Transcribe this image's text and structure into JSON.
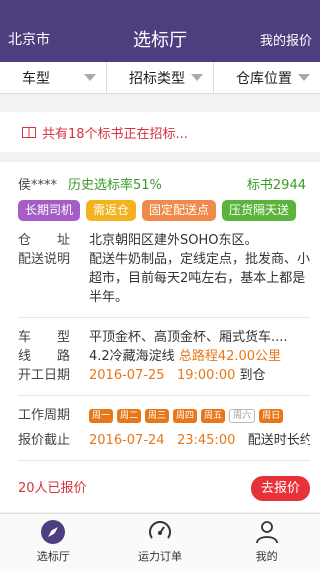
{
  "header": {
    "city": "北京市",
    "title": "选标厅",
    "my_quote": "我的报价"
  },
  "filters": [
    {
      "label": "车型"
    },
    {
      "label": "招标类型"
    },
    {
      "label": "仓库位置"
    }
  ],
  "notice": {
    "text": "共有18个标书正在招标..."
  },
  "card": {
    "user": "侯****",
    "history_rate": "历史选标率51%",
    "bid_no": "标书2944",
    "tags": [
      {
        "label": "长期司机",
        "color": "#a65ec7"
      },
      {
        "label": "需返仓",
        "color": "#f2b31f"
      },
      {
        "label": "固定配送点",
        "color": "#f08a4a"
      },
      {
        "label": "压货隔天送",
        "color": "#5ab33a"
      }
    ],
    "warehouse_label": "仓　　址",
    "warehouse_value": "北京朝阳区建外SOHO东区。",
    "desc_label": "配送说明",
    "desc_value": "配送牛奶制品，定线定点，批发商、小超市，目前每天2吨左右，基本上都是半年。",
    "vehicle_label": "车　　型",
    "vehicle_value": "平顶金杯、高顶金杯、厢式货车....",
    "route_label": "线　　路",
    "route_value": "4.2冷藏海淀线",
    "route_distance": "总路程42.00公里",
    "start_label": "开工日期",
    "start_date": "2016-07-25",
    "start_time": "19:00:00",
    "start_suffix": "到仓",
    "cycle_label": "工作周期",
    "days": [
      {
        "label": "周一",
        "on": true
      },
      {
        "label": "周二",
        "on": true
      },
      {
        "label": "周三",
        "on": true
      },
      {
        "label": "周四",
        "on": true
      },
      {
        "label": "周五",
        "on": true
      },
      {
        "label": "周六",
        "on": false
      },
      {
        "label": "周日",
        "on": true
      }
    ],
    "deadline_label": "报价截止",
    "deadline_date": "2016-07-24",
    "deadline_time": "23:45:00",
    "deadline_extra": "配送时长约1",
    "quote_count": "20人已报价",
    "quote_button": "去报价"
  },
  "tabbar": [
    {
      "label": "选标厅",
      "icon": "compass-icon",
      "active": true
    },
    {
      "label": "运力订单",
      "icon": "gauge-icon",
      "active": false
    },
    {
      "label": "我的",
      "icon": "user-icon",
      "active": false
    }
  ]
}
